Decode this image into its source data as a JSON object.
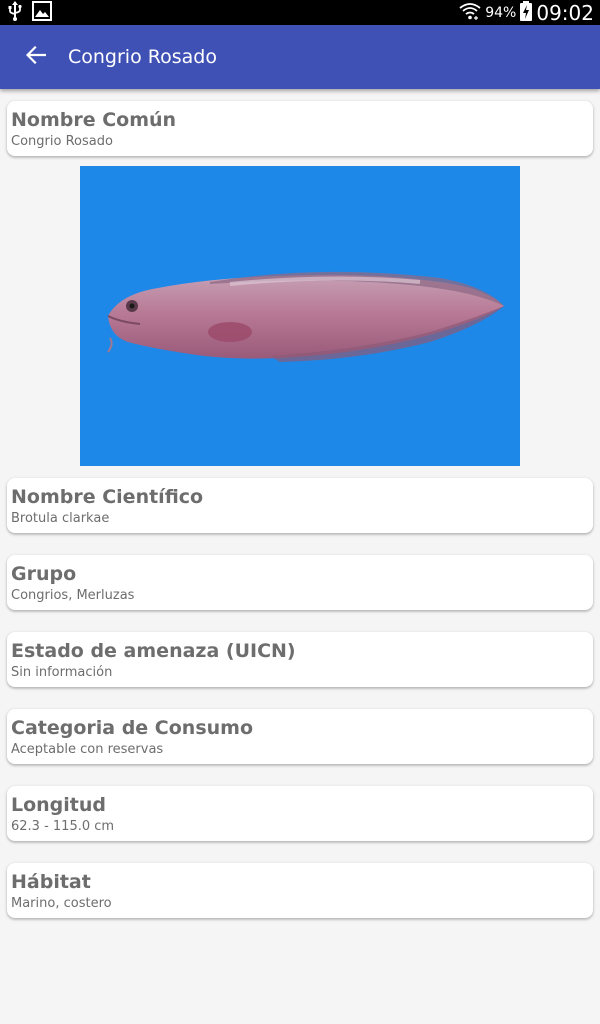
{
  "status_bar": {
    "battery_percent": "94%",
    "time": "09:02"
  },
  "app_bar": {
    "title": "Congrio Rosado"
  },
  "cards": [
    {
      "title": "Nombre Común",
      "value": "Congrio Rosado"
    },
    {
      "title": "Nombre Científico",
      "value": "Brotula clarkae"
    },
    {
      "title": "Grupo",
      "value": "Congrios, Merluzas"
    },
    {
      "title": "Estado de amenaza (UICN)",
      "value": "Sin información"
    },
    {
      "title": "Categoria de Consumo",
      "value": "Aceptable con reservas"
    },
    {
      "title": "Longitud",
      "value": "62.3 - 115.0 cm"
    },
    {
      "title": "Hábitat",
      "value": "Marino, costero"
    }
  ],
  "colors": {
    "app_bar": "#3f51b5",
    "status_bar": "#000000",
    "background": "#f5f5f5",
    "card_text": "#6d6d6d",
    "photo_background": "#1e88e8"
  },
  "icons": {
    "status_left": [
      "usb-icon",
      "image-notification-icon"
    ],
    "status_right": [
      "wifi-icon",
      "battery-charging-icon"
    ],
    "app_bar": "back-arrow-icon"
  }
}
